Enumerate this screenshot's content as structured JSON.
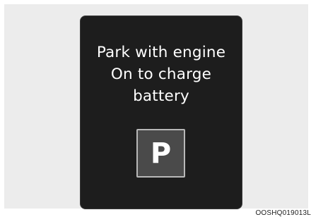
{
  "display": {
    "message_lines": [
      "Park with engine",
      "On to charge",
      "battery"
    ],
    "park_symbol": "P"
  },
  "figure_code": "OOSHQ019013L",
  "colors": {
    "screen_background": "#1d1d1d",
    "text": "#ffffff",
    "park_icon_fill": "#4a4a4a",
    "park_icon_border": "#b8b8b8",
    "frame_background": "#ececec"
  },
  "icons": {
    "park_indicator": "park-p-icon"
  }
}
